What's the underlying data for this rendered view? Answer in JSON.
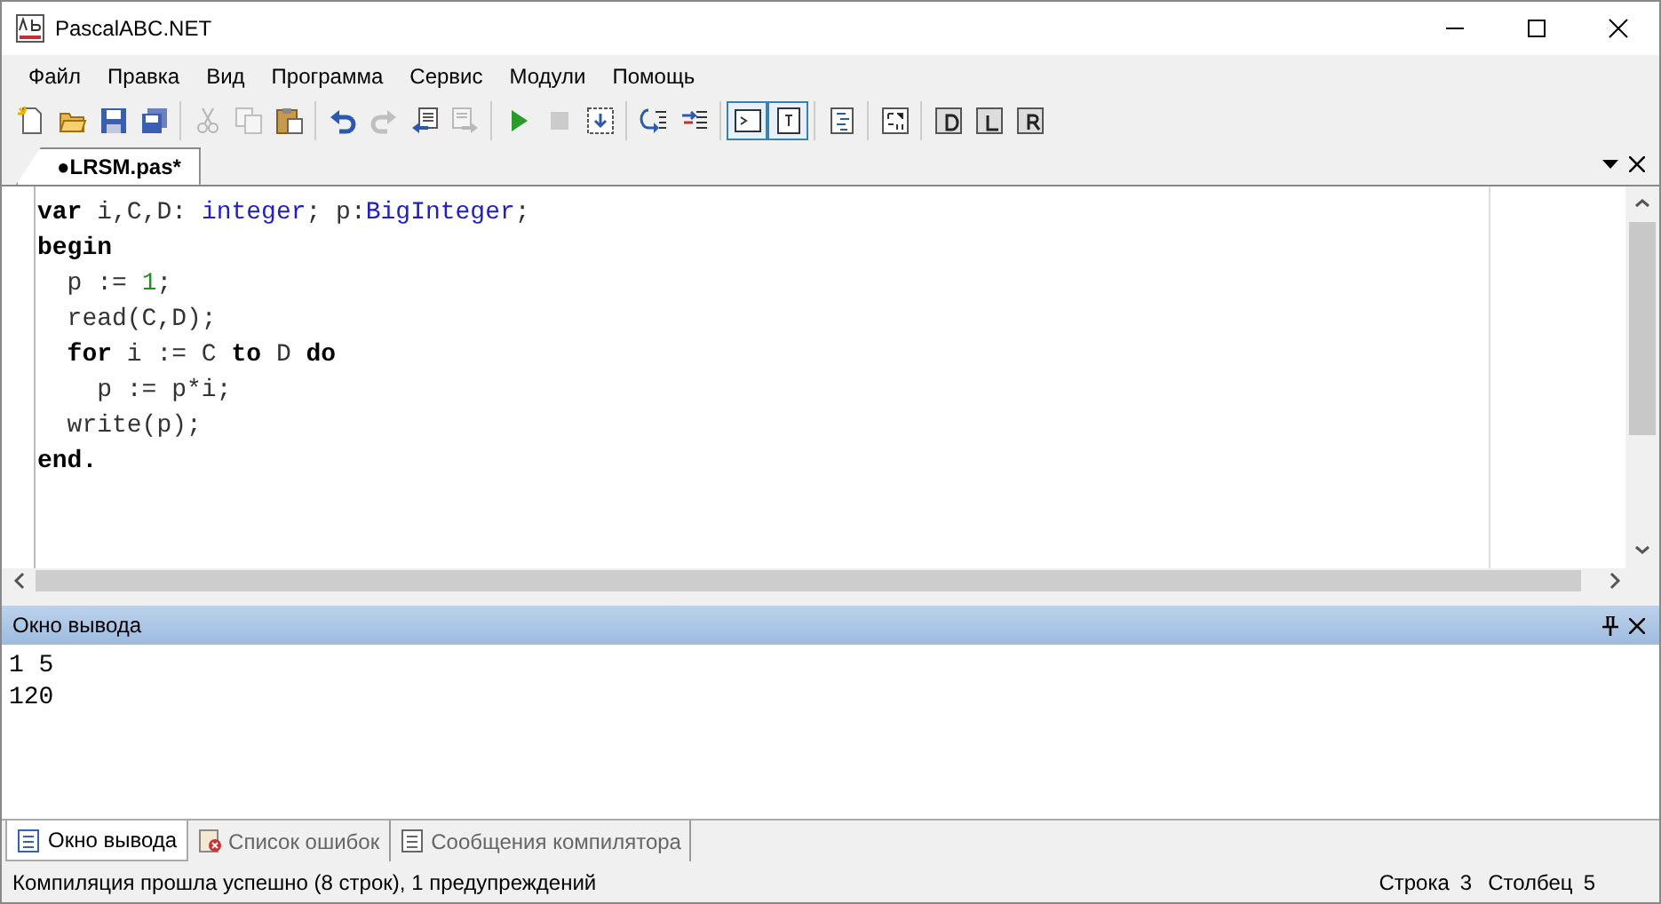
{
  "window": {
    "title": "PascalABC.NET"
  },
  "menu": [
    "Файл",
    "Правка",
    "Вид",
    "Программа",
    "Сервис",
    "Модули",
    "Помощь"
  ],
  "toolbar": [
    [
      {
        "kind": "new",
        "disabled": false,
        "pressed": false
      },
      {
        "kind": "open",
        "disabled": false,
        "pressed": false
      },
      {
        "kind": "save",
        "disabled": false,
        "pressed": false
      },
      {
        "kind": "saveall",
        "disabled": false,
        "pressed": false
      }
    ],
    [
      {
        "kind": "cut",
        "disabled": true,
        "pressed": false
      },
      {
        "kind": "copy",
        "disabled": true,
        "pressed": false
      },
      {
        "kind": "paste",
        "disabled": false,
        "pressed": false
      }
    ],
    [
      {
        "kind": "undo",
        "disabled": false,
        "pressed": false
      },
      {
        "kind": "redo",
        "disabled": true,
        "pressed": false
      },
      {
        "kind": "back",
        "disabled": false,
        "pressed": false
      },
      {
        "kind": "forward",
        "disabled": true,
        "pressed": false
      }
    ],
    [
      {
        "kind": "run",
        "disabled": false,
        "pressed": false
      },
      {
        "kind": "stop",
        "disabled": true,
        "pressed": false
      },
      {
        "kind": "compile",
        "disabled": false,
        "pressed": false
      }
    ],
    [
      {
        "kind": "stepin",
        "disabled": false,
        "pressed": false
      },
      {
        "kind": "stepover",
        "disabled": false,
        "pressed": false
      }
    ],
    [
      {
        "kind": "console",
        "disabled": false,
        "pressed": true
      },
      {
        "kind": "textpanel",
        "disabled": false,
        "pressed": true
      }
    ],
    [
      {
        "kind": "format",
        "disabled": false,
        "pressed": false
      }
    ],
    [
      {
        "kind": "code",
        "disabled": false,
        "pressed": false
      }
    ],
    [
      {
        "kind": "modD",
        "disabled": false,
        "pressed": false
      },
      {
        "kind": "modL",
        "disabled": false,
        "pressed": false
      },
      {
        "kind": "modR",
        "disabled": false,
        "pressed": false
      }
    ]
  ],
  "editor_tabs": [
    {
      "label": "●LRSM.pas*",
      "selected": true
    }
  ],
  "code": [
    [
      {
        "text": "var",
        "kind": "keyword"
      },
      {
        "text": " i,C,D: ",
        "kind": "plain"
      },
      {
        "text": "integer",
        "kind": "type"
      },
      {
        "text": "; p:",
        "kind": "plain"
      },
      {
        "text": "BigInteger",
        "kind": "type"
      },
      {
        "text": ";",
        "kind": "plain"
      }
    ],
    [
      {
        "text": "begin",
        "kind": "keyword"
      }
    ],
    [
      {
        "text": "  p := ",
        "kind": "plain"
      },
      {
        "text": "1",
        "kind": "number"
      },
      {
        "text": ";",
        "kind": "plain"
      }
    ],
    [
      {
        "text": "  read(C,D);",
        "kind": "plain"
      }
    ],
    [
      {
        "text": "  for",
        "kind": "keyword"
      },
      {
        "text": " i := C ",
        "kind": "plain"
      },
      {
        "text": "to",
        "kind": "keyword"
      },
      {
        "text": " D ",
        "kind": "plain"
      },
      {
        "text": "do",
        "kind": "keyword"
      }
    ],
    [
      {
        "text": "    p := p*i;",
        "kind": "plain"
      }
    ],
    [
      {
        "text": "  write(p);",
        "kind": "plain"
      }
    ],
    [
      {
        "text": "end.",
        "kind": "keyword"
      }
    ]
  ],
  "output_panel": {
    "title": "Окно вывода",
    "lines": [
      "1 5",
      "120"
    ]
  },
  "bottom_tabs": [
    {
      "label": "Окно вывода",
      "kind": "output",
      "selected": true
    },
    {
      "label": "Список ошибок",
      "kind": "errors",
      "selected": false
    },
    {
      "label": "Сообщения компилятора",
      "kind": "messages",
      "selected": false
    }
  ],
  "status_bar": {
    "message": "Компиляция прошла успешно (8 строк), 1 предупреждений",
    "line_label": "Строка",
    "line": "3",
    "column_label": "Столбец",
    "column": "5"
  }
}
